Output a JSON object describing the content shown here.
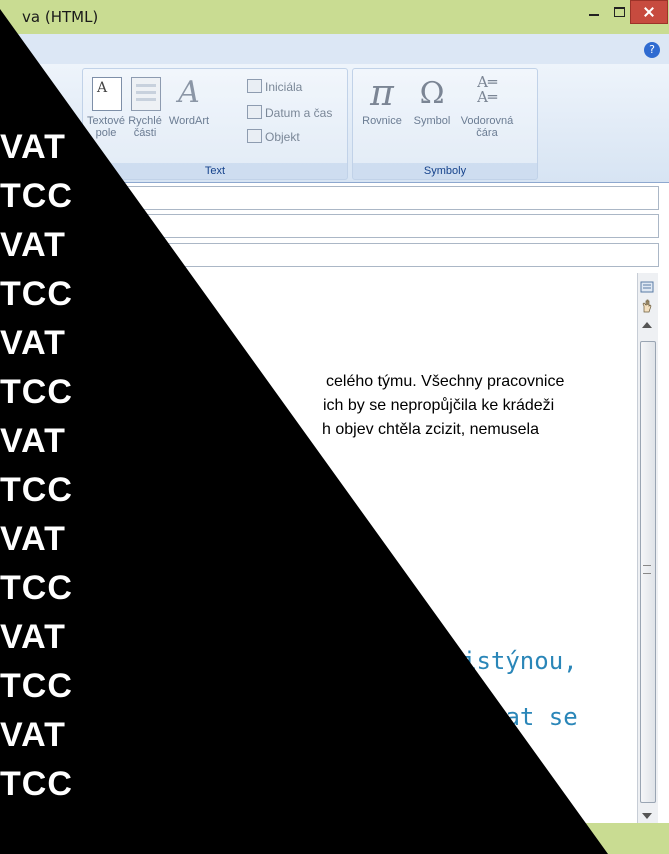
{
  "window": {
    "title": "va (HTML)",
    "help_label": "?"
  },
  "ribbon": {
    "text_group": {
      "label": "Text",
      "buttons": [
        {
          "label": "Textové\npole",
          "caret": "▾"
        },
        {
          "label": "Rychlé\nčásti",
          "caret": "▾"
        },
        {
          "label": "WordArt",
          "caret": "▾"
        }
      ],
      "small_buttons": [
        {
          "label": "Iniciála",
          "caret": "▾"
        },
        {
          "label": "Datum a čas"
        },
        {
          "label": "Objekt"
        }
      ]
    },
    "symbols_group": {
      "label": "Symboly",
      "buttons": [
        {
          "label": "Rovnice",
          "caret": "▾"
        },
        {
          "label": "Symbol",
          "caret": "▾"
        },
        {
          "label": "Vodorovná\nčára"
        }
      ]
    }
  },
  "message": {
    "lines": [
      "celého týmu. Všechny pracovnice",
      "ich by se nepropůjčila ke krádeži",
      "h objev chtěla zcizit, nemusela"
    ],
    "signature_lines": [
      "istýnou,",
      "tat se"
    ]
  },
  "watermark": {
    "rows": [
      "VAT",
      "TCC",
      "VAT",
      "TCC",
      "VAT",
      "TCC",
      "VAT",
      "TCC",
      "VAT",
      "TCC",
      "VAT",
      "TCC",
      "VAT",
      "TCC"
    ]
  }
}
